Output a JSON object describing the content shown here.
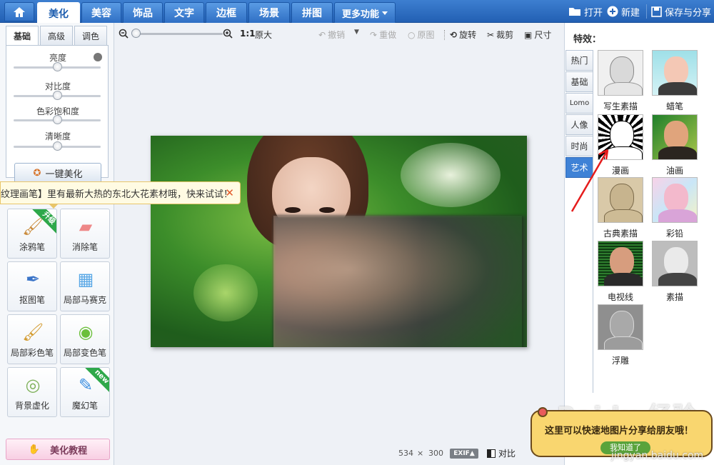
{
  "nav": {
    "tabs": [
      {
        "label": "美化",
        "active": true
      },
      {
        "label": "美容"
      },
      {
        "label": "饰品"
      },
      {
        "label": "文字"
      },
      {
        "label": "边框"
      },
      {
        "label": "场景"
      },
      {
        "label": "拼图"
      }
    ],
    "more_label": "更多功能",
    "open_label": "打开",
    "new_label": "新建",
    "save_label": "保存与分享"
  },
  "left": {
    "sub_tabs": [
      "基础",
      "高级",
      "调色"
    ],
    "sliders": [
      {
        "label": "亮度",
        "value": 0.5
      },
      {
        "label": "对比度",
        "value": 0.5
      },
      {
        "label": "色彩饱和度",
        "value": 0.5
      },
      {
        "label": "清晰度",
        "value": 0.5
      }
    ],
    "one_key_label": "一键美化",
    "tooltip_text": "纹理画笔】里有最新大热的东北大花素材哦，快来试试！",
    "tools": [
      {
        "label": "涂鸦笔",
        "badge": "升级"
      },
      {
        "label": "消除笔"
      },
      {
        "label": "抠图笔"
      },
      {
        "label": "局部马赛克"
      },
      {
        "label": "局部彩色笔"
      },
      {
        "label": "局部变色笔"
      },
      {
        "label": "背景虚化"
      },
      {
        "label": "魔幻笔",
        "badge": "new"
      }
    ],
    "tutorial_label": "美化教程"
  },
  "toolbar": {
    "ratio_label": "1:1",
    "original_size_label": "原大",
    "undo_label": "撤销",
    "redo_label": "重做",
    "original_label": "原图",
    "rotate_label": "旋转",
    "crop_label": "裁剪",
    "size_label": "尺寸"
  },
  "status": {
    "width": "534",
    "times": "×",
    "height": "300",
    "exif_label": "EXIF▲",
    "compare_label": "对比"
  },
  "right": {
    "title": "特效：",
    "categories": [
      {
        "label": "热门"
      },
      {
        "label": "基础"
      },
      {
        "label": "Lomo"
      },
      {
        "label": "人像"
      },
      {
        "label": "时尚"
      },
      {
        "label": "艺术",
        "active": true
      }
    ],
    "effects": [
      {
        "label": "写生素描"
      },
      {
        "label": "蜡笔"
      },
      {
        "label": "漫画"
      },
      {
        "label": "油画"
      },
      {
        "label": "古典素描"
      },
      {
        "label": "彩铅"
      },
      {
        "label": "电视线"
      },
      {
        "label": "素描"
      },
      {
        "label": "浮雕"
      }
    ]
  },
  "overlay": {
    "share_hint": "这里可以快速地图片分享给朋友哦！",
    "got_it": "我知道了",
    "watermark": "Baidu 经验",
    "watermark_url": "jingyan.baidu.com"
  },
  "colors": {
    "accent": "#2f6fc4",
    "active_category": "#3f82d6",
    "badge_green": "#2ea84a"
  }
}
